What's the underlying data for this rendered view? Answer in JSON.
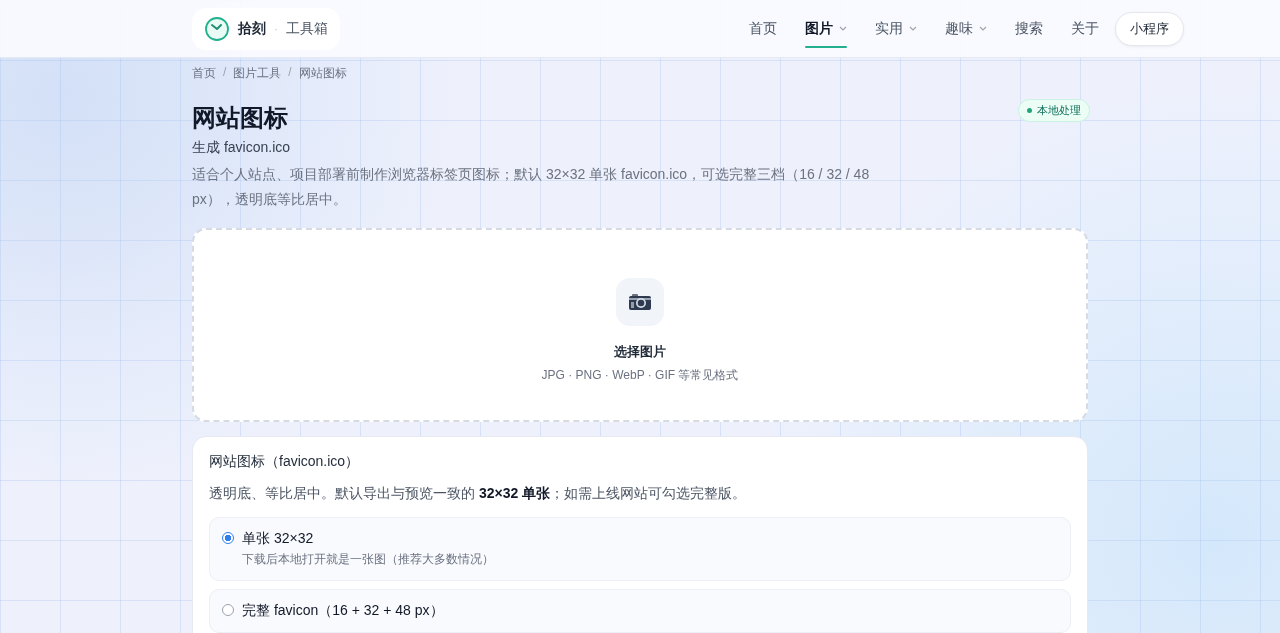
{
  "brand": {
    "name": "拾刻",
    "separator": "·",
    "product": "工具箱"
  },
  "nav": [
    {
      "label": "首页",
      "selected": false,
      "has_menu": false
    },
    {
      "label": "图片",
      "selected": true,
      "has_menu": true
    },
    {
      "label": "实用",
      "selected": false,
      "has_menu": true
    },
    {
      "label": "趣味",
      "selected": false,
      "has_menu": true
    },
    {
      "label": "搜索",
      "selected": false,
      "has_menu": false
    },
    {
      "label": "关于",
      "selected": false,
      "has_menu": false
    }
  ],
  "mini_program_button": "小程序",
  "breadcrumb": [
    "首页",
    "图片工具",
    "网站图标"
  ],
  "breadcrumb_separator": "/",
  "title": "网站图标",
  "badge": "本地处理",
  "subtitle": "生成 favicon.ico",
  "description": "适合个人站点、项目部署前制作浏览器标签页图标；默认 32×32 单张 favicon.ico，可选完整三档（16 / 32 / 48 px），透明底等比居中。",
  "upload": {
    "label": "选择图片",
    "formats": "JPG · PNG · WebP · GIF 等常见格式"
  },
  "options_card": {
    "title": "网站图标（favicon.ico）",
    "intro": "透明底、等比居中。默认导出与预览一致的 **32×32 单张**；如需上线网站可勾选完整版。",
    "options": [
      {
        "title": "单张 32×32",
        "note": "下载后本地打开就是一张图（推荐大多数情况）",
        "selected": true
      },
      {
        "title": "完整 favicon（16 + 32 + 48 px）",
        "selected": false
      }
    ]
  }
}
